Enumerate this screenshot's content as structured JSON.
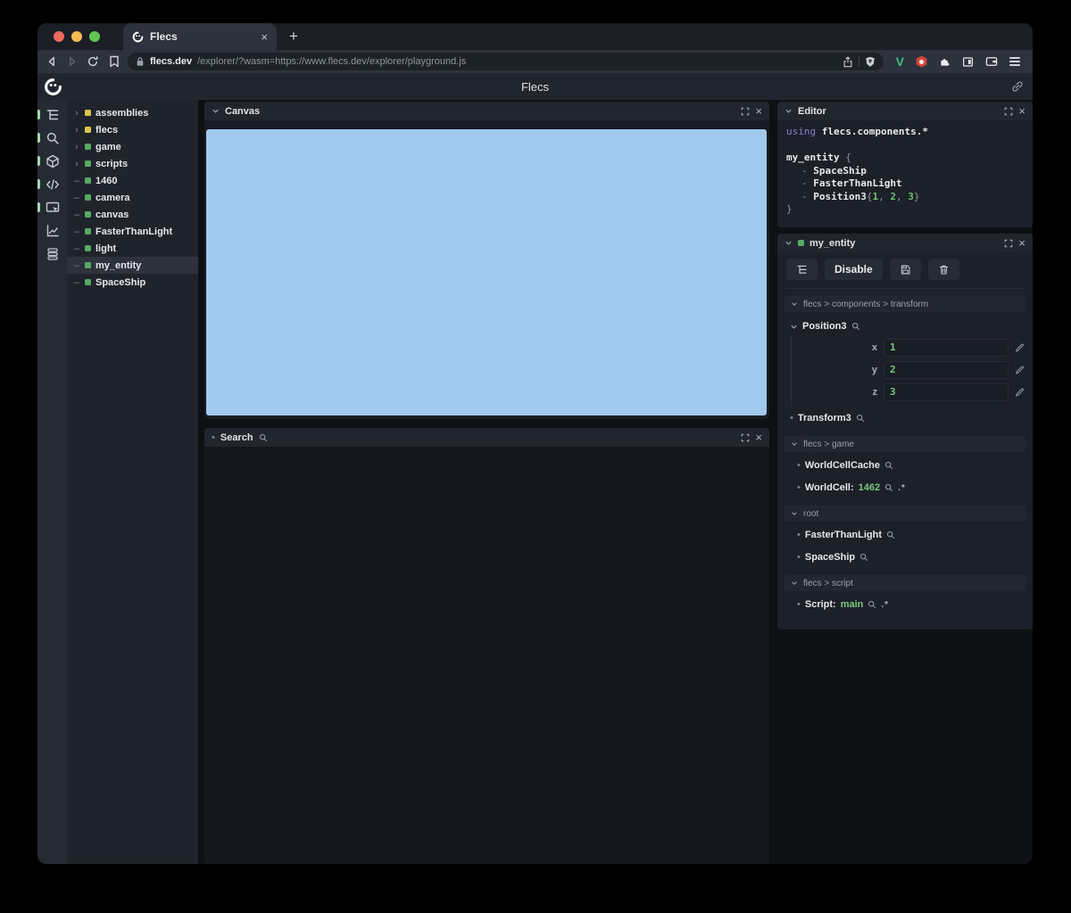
{
  "browser": {
    "tab": {
      "title": "Flecs",
      "close_glyph": "×",
      "new_tab_glyph": "+"
    },
    "url": {
      "domain": "flecs.dev",
      "path": "/explorer/?wasm=https://www.flecs.dev/explorer/playground.js"
    }
  },
  "app": {
    "header": {
      "title": "Flecs"
    },
    "tree": {
      "items": [
        {
          "prefix": "›",
          "label": "assemblies",
          "color": "yellow",
          "selected": false
        },
        {
          "prefix": "›",
          "label": "flecs",
          "color": "yellow",
          "selected": false
        },
        {
          "prefix": "›",
          "label": "game",
          "color": "green",
          "selected": false
        },
        {
          "prefix": "›",
          "label": "scripts",
          "color": "green",
          "selected": false
        },
        {
          "prefix": "–",
          "label": "1460",
          "color": "green",
          "selected": false
        },
        {
          "prefix": "–",
          "label": "camera",
          "color": "green",
          "selected": false
        },
        {
          "prefix": "–",
          "label": "canvas",
          "color": "green",
          "selected": false
        },
        {
          "prefix": "–",
          "label": "FasterThanLight",
          "color": "green",
          "selected": false
        },
        {
          "prefix": "–",
          "label": "light",
          "color": "green",
          "selected": false
        },
        {
          "prefix": "–",
          "label": "my_entity",
          "color": "green",
          "selected": true
        },
        {
          "prefix": "–",
          "label": "SpaceShip",
          "color": "green",
          "selected": false
        }
      ]
    },
    "canvas_panel": {
      "title": "Canvas"
    },
    "search_panel": {
      "title": "Search",
      "bullet": "•"
    },
    "editor": {
      "title": "Editor",
      "code": {
        "kw_using": "using",
        "using_rest": " flecs.components.*",
        "entity_name": "my_entity",
        "open_brace": " {",
        "dash": "- ",
        "comp1": "SpaceShip",
        "comp2": "FasterThanLight",
        "comp3_name": "Position3",
        "comp3_open": "{",
        "n1": "1",
        "c1": ", ",
        "n2": "2",
        "c2": ", ",
        "n3": "3",
        "comp3_close": "}",
        "close_brace": "}"
      }
    },
    "inspector": {
      "title": "my_entity",
      "disable_label": "Disable",
      "sections": {
        "transform": "flecs > components > transform",
        "game": "flecs > game",
        "root": "root",
        "script": "flecs > script"
      },
      "position3": {
        "name": "Position3",
        "fields": [
          {
            "label": "x",
            "value": "1"
          },
          {
            "label": "y",
            "value": "2"
          },
          {
            "label": "z",
            "value": "3"
          }
        ]
      },
      "transform3": "Transform3",
      "world_cell_cache": "WorldCellCache",
      "world_cell": {
        "label": "WorldCell:",
        "value": "1462",
        "pair": ".*"
      },
      "root_items": [
        "FasterThanLight",
        "SpaceShip"
      ],
      "script": {
        "label": "Script:",
        "value": "main",
        "pair": ".*"
      }
    }
  },
  "colors": {
    "canvas_blue": "#a0c9ee",
    "entity_green": "#56a963",
    "module_yellow": "#d9c44f",
    "value_green": "#7cc87f",
    "keyword_purple": "#8b7ad8",
    "number_green": "#6ec06e",
    "pill_green": "#a3d9ab",
    "vue_green": "#42b883",
    "ext_red": "#d2463c",
    "selected_row": "#2d323d"
  }
}
